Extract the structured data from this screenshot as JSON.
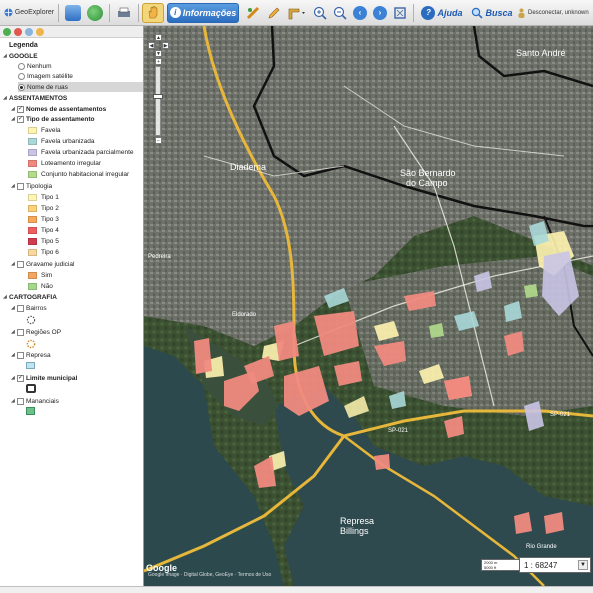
{
  "toolbar": {
    "app_name": "GeoExplorer",
    "informacoes_label": "Informações",
    "ajuda_label": "Ajuda",
    "busca_label": "Busca",
    "user_status": "Desconectar, unknown"
  },
  "legend": {
    "title": "Legenda",
    "google": {
      "label": "GOOGLE",
      "options": [
        "Nenhum",
        "Imagem satélite",
        "Nome de ruas"
      ],
      "selected": "Nome de ruas"
    },
    "assentamentos": {
      "label": "ASSENTAMENTOS",
      "nomes_label": "Nomes de assentamentos",
      "tipo_label": "Tipo de assentamento",
      "tipo_items": [
        {
          "label": "Favela",
          "color": "#fff4b0"
        },
        {
          "label": "Favela urbanizada",
          "color": "#a8d8d8"
        },
        {
          "label": "Favela urbanizada parcialmente",
          "color": "#c9c4e6"
        },
        {
          "label": "Loteamento irregular",
          "color": "#f08a80"
        },
        {
          "label": "Conjunto habitacional irregular",
          "color": "#b2dc8c"
        }
      ],
      "tipologia_label": "Tipologia",
      "tipologia_items": [
        {
          "label": "Tipo 1",
          "color": "#fff6b4"
        },
        {
          "label": "Tipo 2",
          "color": "#ffd27a"
        },
        {
          "label": "Tipo 3",
          "color": "#f7a85a"
        },
        {
          "label": "Tipo 4",
          "color": "#ef5f5f"
        },
        {
          "label": "Tipo 5",
          "color": "#d23c4f"
        },
        {
          "label": "Tipo 6",
          "color": "#f8d89c"
        }
      ],
      "gravame_label": "Gravame judicial",
      "gravame_items": [
        {
          "label": "Sim",
          "color": "#f4a560"
        },
        {
          "label": "Não",
          "color": "#a4d98c"
        }
      ]
    },
    "cartografia": {
      "label": "CARTOGRAFIA",
      "bairros_label": "Bairros",
      "regioes_label": "Regiões OP",
      "represa_label": "Represa",
      "limite_label": "Limite municipal",
      "mananciais_label": "Mananciais"
    }
  },
  "map": {
    "labels": {
      "santo_andre": "Santo André",
      "sao_bernardo_1": "São Bernardo",
      "sao_bernardo_2": "do Campo",
      "diadema": "Diadema",
      "eldorado": "Eldorado",
      "represa_1": "Represa",
      "represa_2": "Billings",
      "rio_grande": "Rio Grande",
      "pedreira": "Pedreira",
      "sp021": "SP-021",
      "sp031": "SP-021"
    },
    "scale_label": "1 : 68247",
    "scalebar_top": "2000 m",
    "scalebar_bottom": "5000 ft",
    "attribution": "Google Image · Digital Globe, GeoEye · Termos de Uso",
    "google_logo": "Google"
  },
  "colors": {
    "favela": "#fff4b0",
    "urbanizada": "#a8d8d8",
    "parcial": "#c9c4e6",
    "loteamento": "#f08a80",
    "conjunto": "#b2dc8c",
    "road": "#e6b73a",
    "water": "#2f4a4e"
  }
}
